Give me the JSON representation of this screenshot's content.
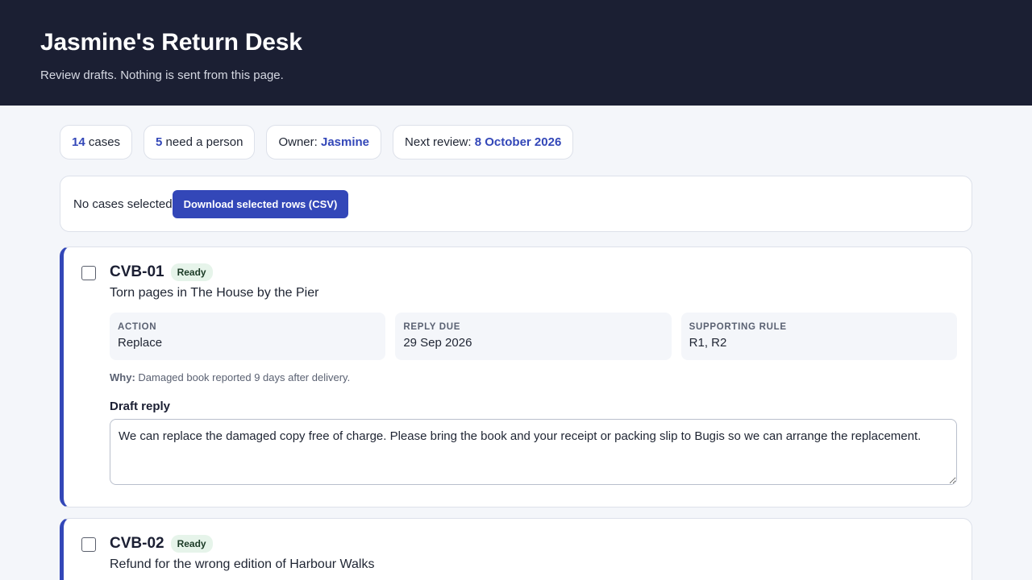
{
  "header": {
    "title": "Jasmine's Return Desk",
    "subtitle": "Review drafts. Nothing is sent from this page."
  },
  "stats": {
    "cases_count": "14",
    "cases_label": " cases",
    "need_count": "5",
    "need_label": " need a person",
    "owner_label": "Owner: ",
    "owner_value": "Jasmine",
    "review_label": "Next review: ",
    "review_value": "8 October 2026"
  },
  "selection": {
    "status": "No cases selected",
    "download_label": "Download selected rows (CSV)"
  },
  "cases": [
    {
      "id": "CVB-01",
      "status": "Ready",
      "title": "Torn pages in The House by the Pier",
      "facts": [
        {
          "label": "ACTION",
          "value": "Replace"
        },
        {
          "label": "REPLY DUE",
          "value": "29 Sep 2026"
        },
        {
          "label": "SUPPORTING RULE",
          "value": "R1, R2"
        }
      ],
      "why_label": "Why:",
      "why_text": " Damaged book reported 9 days after delivery.",
      "draft_label": "Draft reply",
      "draft_text": "We can replace the damaged copy free of charge. Please bring the book and your receipt or packing slip to Bugis so we can arrange the replacement."
    },
    {
      "id": "CVB-02",
      "status": "Ready",
      "title": "Refund for the wrong edition of Harbour Walks"
    }
  ],
  "colors": {
    "accent": "#3347b8",
    "header_bg": "#1b1f33",
    "ready_badge_bg": "#e6f4ea"
  }
}
